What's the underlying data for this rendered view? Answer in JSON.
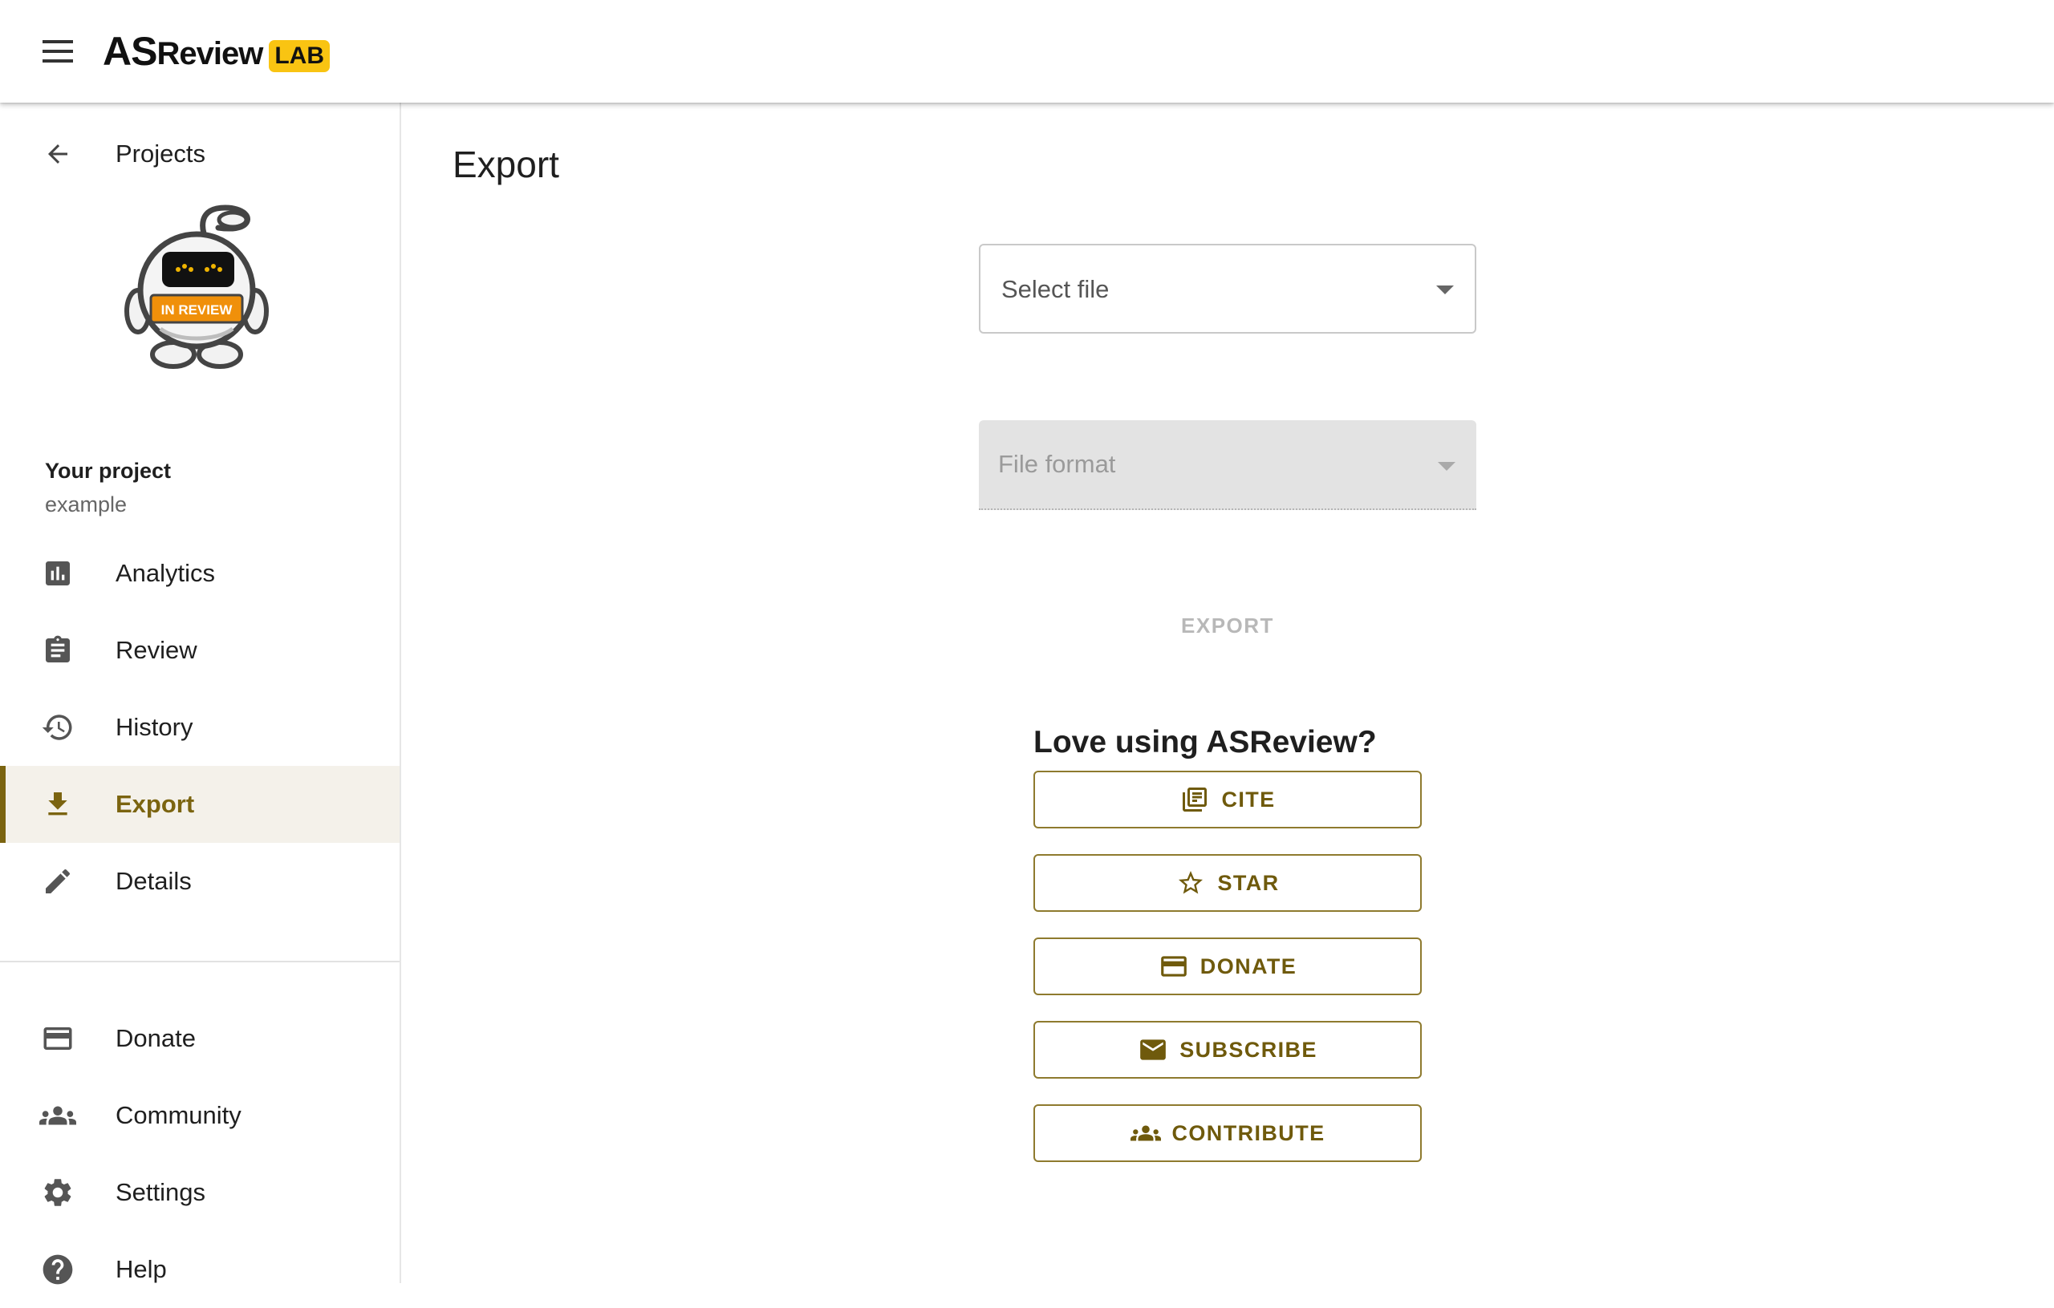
{
  "appbar": {
    "brand_as": "AS",
    "brand_review": "Review",
    "brand_lab": "LAB"
  },
  "sidebar": {
    "back_label": "Projects",
    "mascot_badge": "IN REVIEW",
    "project_caption": "Your project",
    "project_name": "example",
    "items": [
      {
        "label": "Analytics",
        "icon": "analytics-icon"
      },
      {
        "label": "Review",
        "icon": "clipboard-icon"
      },
      {
        "label": "History",
        "icon": "history-icon"
      },
      {
        "label": "Export",
        "icon": "download-icon",
        "active": true
      },
      {
        "label": "Details",
        "icon": "pencil-icon"
      }
    ],
    "footer_items": [
      {
        "label": "Donate",
        "icon": "credit-card-icon"
      },
      {
        "label": "Community",
        "icon": "group-icon"
      },
      {
        "label": "Settings",
        "icon": "gear-icon"
      },
      {
        "label": "Help",
        "icon": "help-icon"
      }
    ]
  },
  "main": {
    "title": "Export",
    "select_file_placeholder": "Select file",
    "file_format_placeholder": "File format",
    "export_label": "EXPORT",
    "love_title": "Love using ASReview?",
    "cta_buttons": [
      {
        "label": "CITE",
        "icon": "library-books-icon"
      },
      {
        "label": "STAR",
        "icon": "star-outline-icon"
      },
      {
        "label": "DONATE",
        "icon": "credit-card-icon"
      },
      {
        "label": "SUBSCRIBE",
        "icon": "mail-icon"
      },
      {
        "label": "CONTRIBUTE",
        "icon": "group-icon"
      }
    ]
  },
  "colors": {
    "accent": "#7b6410",
    "active_bg": "#f4f1ea",
    "brand_lab_bg": "#f9c412",
    "mascot_badge": "#f0900a",
    "disabled_text": "#b8b8b8"
  }
}
